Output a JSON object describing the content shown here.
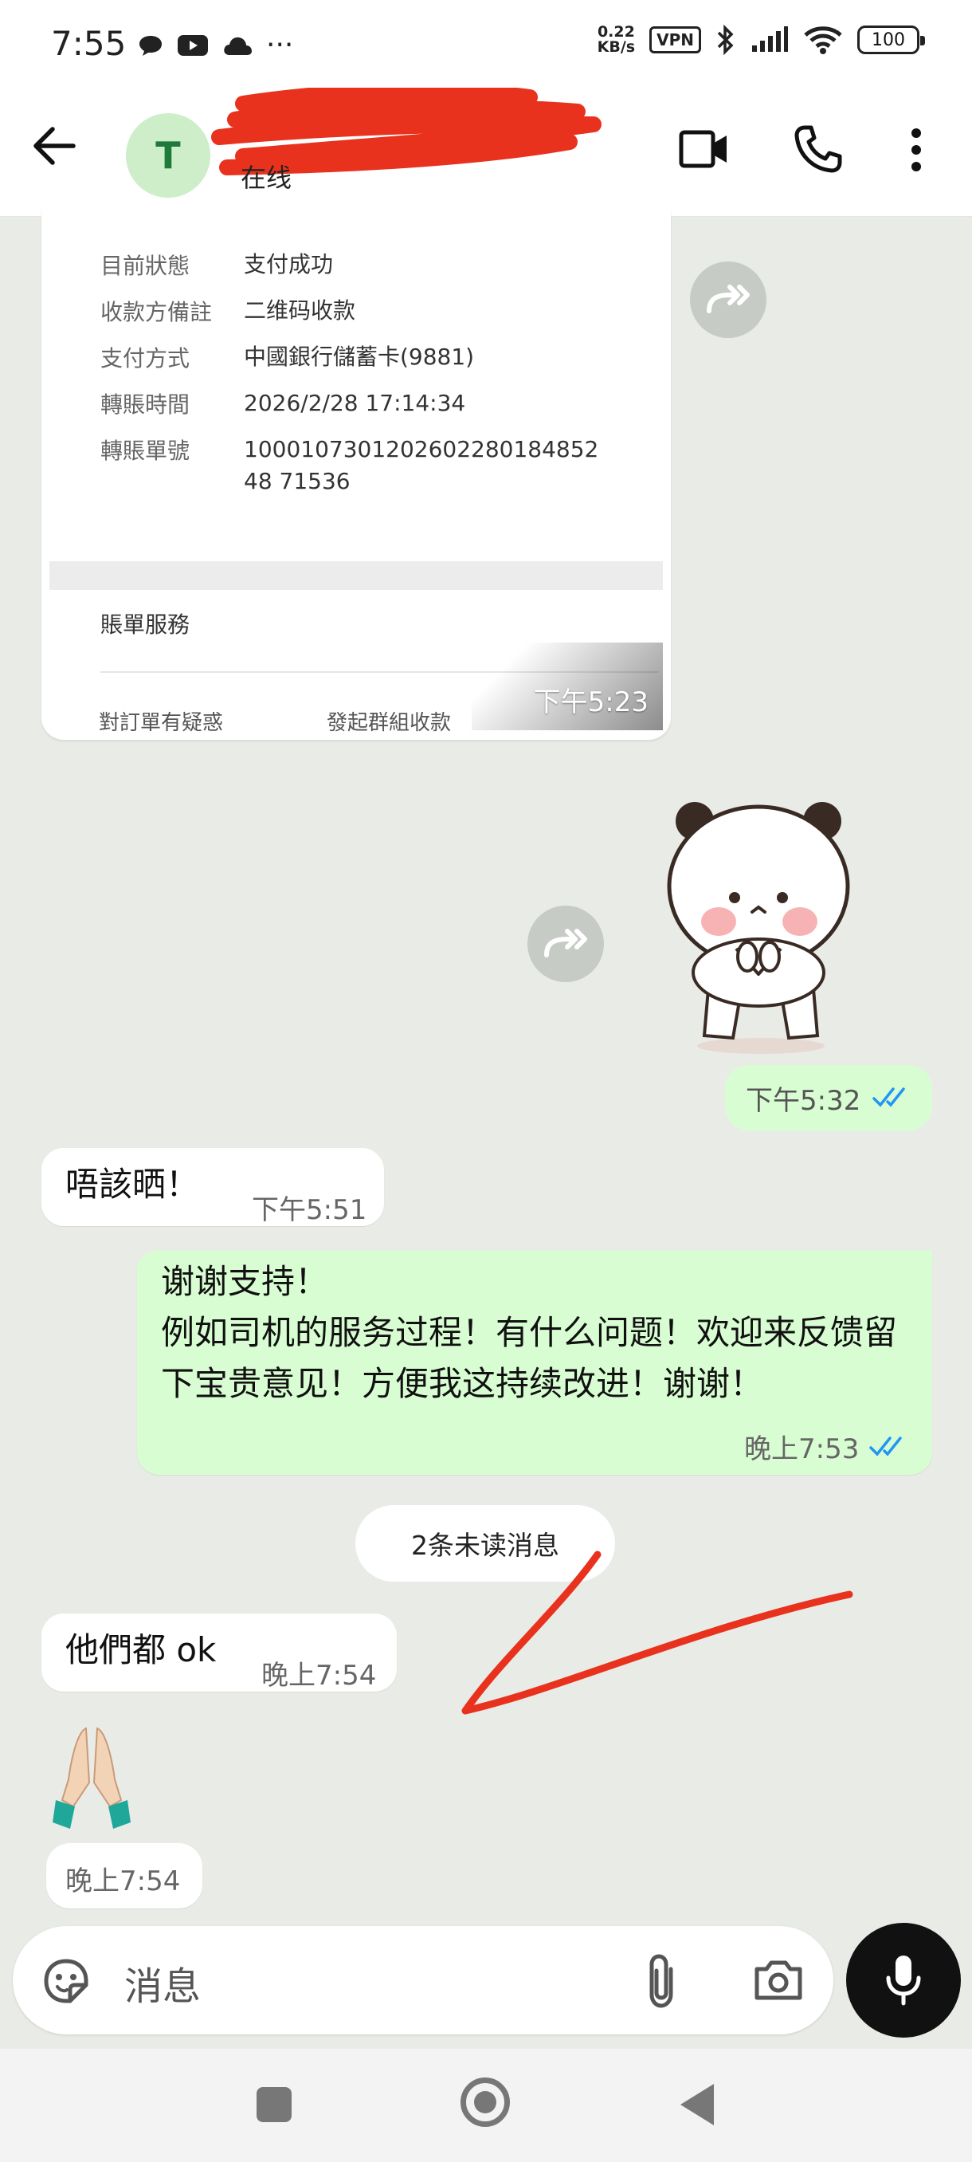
{
  "status_bar": {
    "time": "7:55",
    "more_dots": "···",
    "net_speed_value": "0.22",
    "net_speed_unit": "KB/s",
    "vpn_label": "VPN",
    "battery": "100"
  },
  "header": {
    "avatar_letter": "T",
    "contact_status": "在线"
  },
  "receipt": {
    "rows": [
      {
        "label": "目前狀態",
        "value": "支付成功"
      },
      {
        "label": "收款方備註",
        "value": "二维码收款"
      },
      {
        "label": "支付方式",
        "value": "中國銀行儲蓄卡(9881)"
      },
      {
        "label": "轉賬時間",
        "value": "2026/2/28 17:14:34"
      },
      {
        "label": "轉賬單號",
        "value": "100010730120260228018485248 71536"
      }
    ],
    "service_label": "賬單服務",
    "bottom_left": "對訂單有疑惑",
    "bottom_right": "發起群組收款",
    "time": "下午5:23"
  },
  "messages": [
    {
      "id": "sticker",
      "time": "下午5:32"
    },
    {
      "id": "m1",
      "text": "唔該晒！",
      "time": "下午5:51"
    },
    {
      "id": "m2",
      "text": "谢谢支持！\n例如司机的服务过程！有什么问题！欢迎来反馈留下宝贵意见！方便我这持续改进！谢谢！",
      "time": "晚上7:53"
    },
    {
      "id": "m3",
      "text": "他們都 ok",
      "time": "晚上7:54"
    },
    {
      "id": "m4",
      "emoji": "🙏",
      "time": "晚上7:54"
    }
  ],
  "unread_label": "2条未读消息",
  "input": {
    "placeholder": "消息"
  },
  "colors": {
    "outgoing_bubble": "#d9fdd3",
    "incoming_bubble": "#ffffff",
    "chat_background": "#e9ece6",
    "read_ticks": "#2196f3",
    "annotation_red": "#e8321e"
  }
}
